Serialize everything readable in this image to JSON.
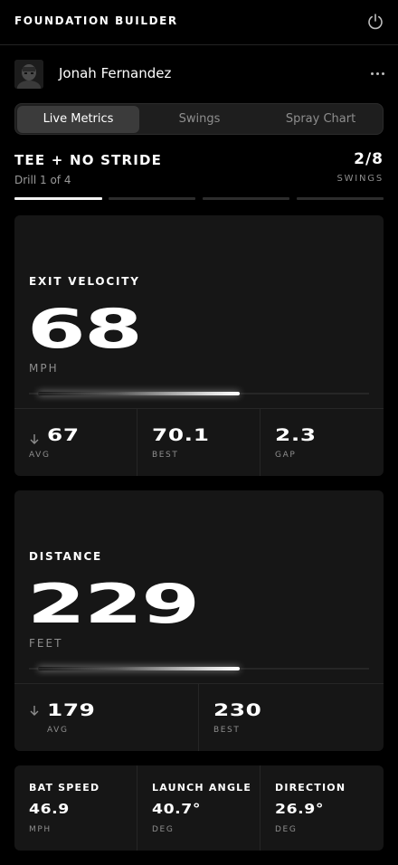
{
  "header": {
    "title": "FOUNDATION BUILDER",
    "power_icon": "power-icon"
  },
  "profile": {
    "name": "Jonah Fernandez",
    "more_icon": "more-horizontal-icon"
  },
  "tabs": [
    {
      "label": "Live Metrics",
      "active": true
    },
    {
      "label": "Swings",
      "active": false
    },
    {
      "label": "Spray Chart",
      "active": false
    }
  ],
  "drill": {
    "title": "TEE + NO STRIDE",
    "subtitle": "Drill 1 of 4",
    "swing_count": "2/8",
    "swing_label": "SWINGS",
    "progress": {
      "completed_segments": 1,
      "total_segments": 4
    }
  },
  "exit_velocity": {
    "label": "EXIT VELOCITY",
    "value": "68",
    "unit": "MPH",
    "meter_level": 0.62,
    "stats": [
      {
        "value": "67",
        "label": "AVG",
        "trend": "down"
      },
      {
        "value": "70.1",
        "label": "BEST"
      },
      {
        "value": "2.3",
        "label": "GAP"
      }
    ]
  },
  "distance": {
    "label": "DISTANCE",
    "value": "229",
    "unit": "FEET",
    "meter_level": 0.62,
    "stats": [
      {
        "value": "179",
        "label": "AVG",
        "trend": "down"
      },
      {
        "value": "230",
        "label": "BEST"
      }
    ]
  },
  "bottom_metrics": [
    {
      "label": "BAT SPEED",
      "value": "46.9",
      "unit": "MPH"
    },
    {
      "label": "LAUNCH ANGLE",
      "value": "40.7°",
      "unit": "DEG"
    },
    {
      "label": "DIRECTION",
      "value": "26.9°",
      "unit": "DEG"
    }
  ],
  "colors": {
    "background": "#000000",
    "card": "#161616",
    "accent": "#ffffff",
    "muted": "#8e8e8e"
  }
}
